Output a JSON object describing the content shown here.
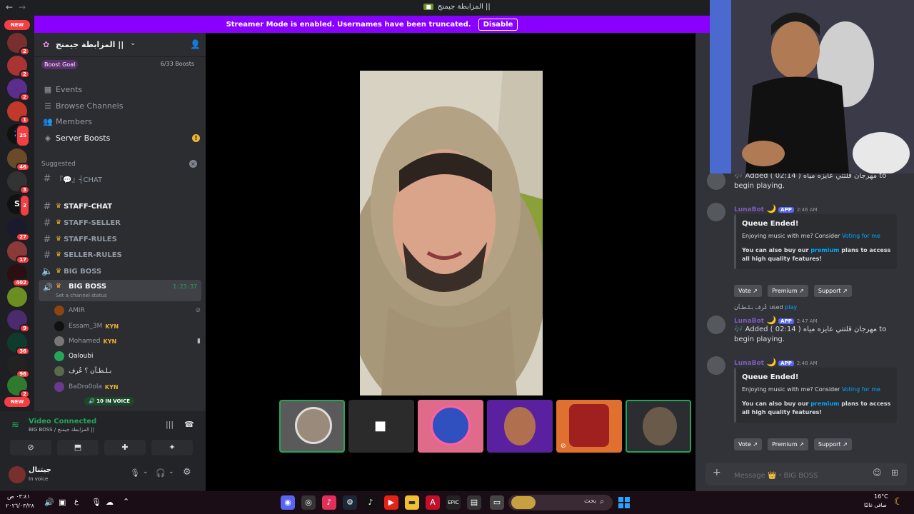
{
  "window": {
    "title": "المزابطة جيمنج ||",
    "back": "←",
    "forward": "→"
  },
  "banner": {
    "text": "Streamer Mode is enabled. Usernames have been truncated.",
    "button": "Disable"
  },
  "rail": {
    "new_top": "NEW",
    "new_bottom": "NEW",
    "badges": [
      "2",
      "2",
      "2",
      "1",
      "25",
      "46",
      "3",
      "2",
      "27",
      "17",
      "402",
      "9",
      "36",
      "96",
      "2"
    ]
  },
  "server": {
    "name": "المزابطة جيمنج ||",
    "boost_goal": "Boost Goal",
    "boost_count": "6/33 Boosts"
  },
  "nav": [
    {
      "icon": "calendar-icon",
      "label": "Events"
    },
    {
      "icon": "browse-icon",
      "label": "Browse Channels"
    },
    {
      "icon": "members-icon",
      "label": "Members"
    },
    {
      "icon": "boost-icon",
      "label": "Server Boosts"
    }
  ],
  "suggested": {
    "label": "Suggested",
    "channel": "『💬』┤CHAT"
  },
  "channels": [
    {
      "name": "STAFF-CHAT",
      "type": "text"
    },
    {
      "name": "STAFF-SELLER",
      "type": "text"
    },
    {
      "name": "STAFF-RULES",
      "type": "text"
    },
    {
      "name": "SELLER-RULES",
      "type": "text"
    },
    {
      "name": "BIG BOSS",
      "type": "voice"
    },
    {
      "name": "BIG BOSS",
      "type": "voice-active",
      "timer": "1:23:37",
      "status": "Set a channel status"
    }
  ],
  "voice_users": [
    {
      "name": "AMIR",
      "tag": ""
    },
    {
      "name": "Essam_3M",
      "tag": "KYN"
    },
    {
      "name": "Mohamed",
      "tag": "KYN"
    },
    {
      "name": "Qaloubi",
      "tag": ""
    },
    {
      "name": "بـلـطـآن ؟ عُرف",
      "tag": ""
    },
    {
      "name": "BaDro0ola",
      "tag": "KYN"
    }
  ],
  "in_voice_pill": "10 IN VOICE",
  "voice_panel": {
    "status": "Video Connected",
    "channel": "BIG BOSS / المزابطة جيمنج ||",
    "username": "جيتنال",
    "substatus": "In voice"
  },
  "chat": {
    "messages": [
      {
        "type": "text",
        "body": "Added ( 02:14 ) مهرجان قلتتي عايزه مياه to begin playing."
      },
      {
        "type": "embed",
        "bot": "LunaBot",
        "app": "APP",
        "time": "2:46 AM",
        "title": "Queue Ended!",
        "line1": "Enjoying music with me? Consider",
        "line1_link": "Voting for me",
        "line2a": "You can also buy our",
        "line2_link": "premium",
        "line2b": "plans to access all high quality features!",
        "buttons": [
          "Vote",
          "Premium",
          "Support"
        ]
      },
      {
        "type": "reply",
        "user": "عُرف بـلـطـآن",
        "used": "used",
        "command": "play"
      },
      {
        "type": "bot_text",
        "bot": "LunaBot",
        "app": "APP",
        "time": "2:47 AM",
        "body": "Added ( 02:14 ) مهرجان قلتتي عايزه مياه to begin playing."
      },
      {
        "type": "embed",
        "bot": "LunaBot",
        "app": "APP",
        "time": "2:48 AM",
        "title": "Queue Ended!",
        "line1": "Enjoying music with me? Consider",
        "line1_link": "Voting for me",
        "line2a": "You can also buy our",
        "line2_link": "premium",
        "line2b": "plans to access all high quality features!",
        "buttons": [
          "Vote",
          "Premium",
          "Support"
        ]
      }
    ],
    "placeholder": "Message 👑・BIG BOSS"
  },
  "taskbar": {
    "search": "بحث",
    "time": "٠٣:٤١ ص",
    "date": "٢٠٢٦/٠٣/٢٨",
    "weather_temp": "16°C",
    "weather_text": "صافي غالبًا",
    "lang": "ع"
  }
}
